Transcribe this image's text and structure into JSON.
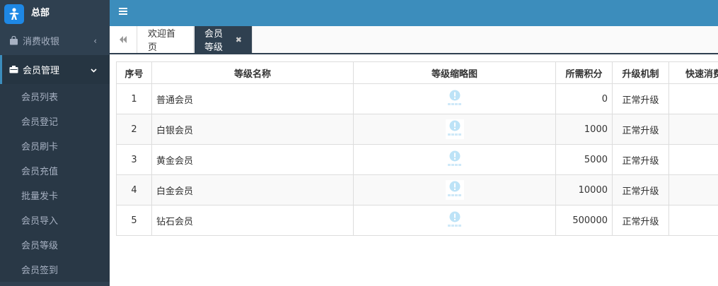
{
  "sidebar": {
    "brand": "总部",
    "menus": [
      {
        "label": "消费收银",
        "icon": "shopping-bag-icon",
        "arrow": "‹"
      },
      {
        "label": "会员管理",
        "icon": "id-card-icon",
        "arrow": "⌄"
      }
    ],
    "submenu": [
      "会员列表",
      "会员登记",
      "会员刷卡",
      "会员充值",
      "批量发卡",
      "会员导入",
      "会员等级",
      "会员签到"
    ]
  },
  "tabs": [
    {
      "label": "欢迎首页"
    },
    {
      "label": "会员等级",
      "close": "✖"
    }
  ],
  "table": {
    "headers": [
      "序号",
      "等级名称",
      "等级缩略图",
      "所需积分",
      "升级机制",
      "快速消费"
    ],
    "rows": [
      {
        "num": "1",
        "name": "普通会员",
        "points": "0",
        "mech": "正常升级"
      },
      {
        "num": "2",
        "name": "白银会员",
        "points": "1000",
        "mech": "正常升级"
      },
      {
        "num": "3",
        "name": "黄金会员",
        "points": "5000",
        "mech": "正常升级"
      },
      {
        "num": "4",
        "name": "白金会员",
        "points": "10000",
        "mech": "正常升级"
      },
      {
        "num": "5",
        "name": "钻石会员",
        "points": "500000",
        "mech": "正常升级"
      }
    ]
  },
  "colors": {
    "sidebar": "#2f4050",
    "topbar": "#3c8dbc",
    "accent": "#3c8dbc"
  }
}
